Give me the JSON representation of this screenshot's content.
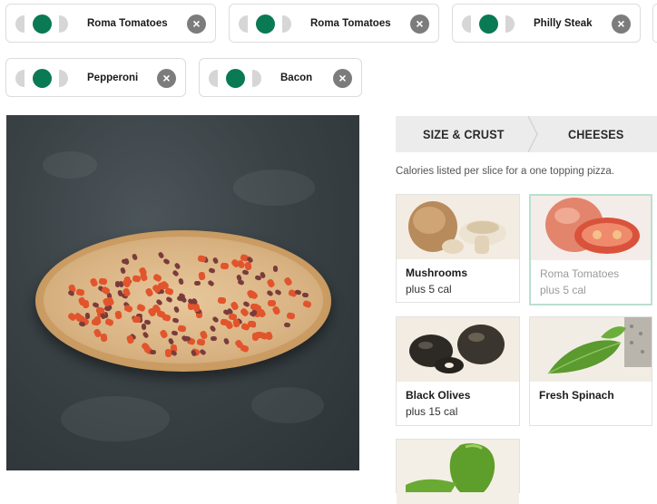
{
  "selected_toppings": [
    {
      "name": "Roma Tomatoes"
    },
    {
      "name": "Roma Tomatoes"
    },
    {
      "name": "Philly Steak"
    },
    {
      "name": "Pepperoni"
    },
    {
      "name": "Bacon"
    }
  ],
  "remove_glyph": "×",
  "tabs": [
    "SIZE & CRUST",
    "CHEESES"
  ],
  "calories_note": "Calories listed per slice for a one topping pizza.",
  "toppings": [
    {
      "name": "Mushrooms",
      "cal": "plus 5 cal",
      "selected": false
    },
    {
      "name": "Roma Tomatoes",
      "cal": "plus 5 cal",
      "selected": true
    },
    {
      "name": "Black Olives",
      "cal": "plus 15 cal",
      "selected": false
    },
    {
      "name": "Fresh Spinach",
      "cal": "",
      "selected": false
    },
    {
      "name": "",
      "cal": "",
      "selected": false
    }
  ],
  "colors": {
    "accent": "#0a7a55",
    "selected_border": "#b9e0cf"
  }
}
